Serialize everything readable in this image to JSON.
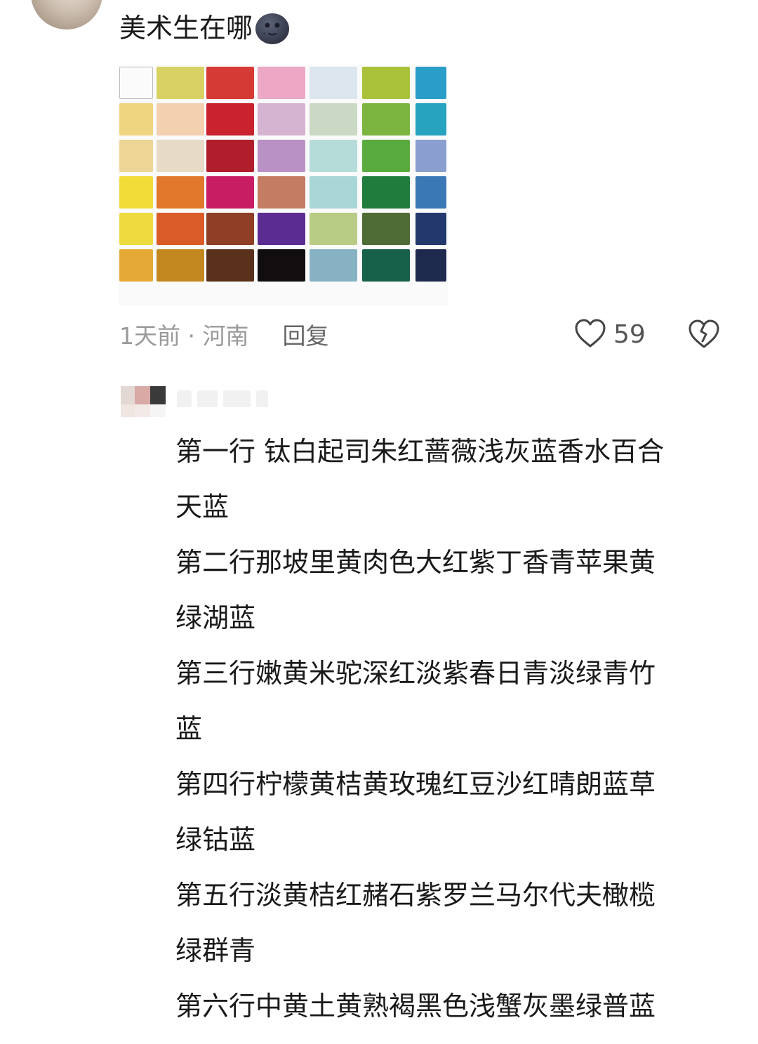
{
  "comment": {
    "text": "美术生在哪",
    "emoji": "new-moon-face-emoji"
  },
  "palette": {
    "rows": [
      [
        "#fbfbfb",
        "#d7d263",
        "#d63a34",
        "#eca8c4",
        "#dde5ee",
        "#a9c23a",
        "#2a9ec8"
      ],
      [
        "#efd57f",
        "#f3d1b0",
        "#c9242e",
        "#d5b4d2",
        "#cbd9c4",
        "#7bb43e",
        "#27a3c0"
      ],
      [
        "#ecd595",
        "#e7dac7",
        "#b01e2c",
        "#ba91c4",
        "#b6dcda",
        "#5aab3f",
        "#8a9fd0"
      ],
      [
        "#f2dc38",
        "#e2782c",
        "#c81d62",
        "#c47c63",
        "#a9d6d6",
        "#1f7c3c",
        "#3a78b5"
      ],
      [
        "#eedb3f",
        "#d95c27",
        "#8f3f25",
        "#5b2c92",
        "#b9cc86",
        "#4f6b36",
        "#23396e"
      ],
      [
        "#e4aa35",
        "#c3871f",
        "#5a321c",
        "#120d0e",
        "#87b2c4",
        "#17604a",
        "#1d2a4e"
      ]
    ]
  },
  "meta": {
    "time_location": "1天前 · 河南",
    "reply_label": "回复",
    "like_count": "59",
    "like_icon": "heart-outline-icon",
    "dislike_icon": "broken-heart-icon"
  },
  "reply": {
    "lines": [
      "第一行 钛白起司朱红蔷薇浅灰蓝香水百合",
      "天蓝",
      "第二行那坡里黄肉色大红紫丁香青苹果黄",
      "绿湖蓝",
      "第三行嫩黄米驼深红淡紫春日青淡绿青竹",
      "蓝",
      "第四行柠檬黄桔黄玫瑰红豆沙红晴朗蓝草",
      "绿钴蓝",
      "第五行淡黄桔红赭石紫罗兰马尔代夫橄榄",
      "绿群青",
      "第六行中黄土黄熟褐黑色浅蟹灰墨绿普蓝"
    ]
  }
}
